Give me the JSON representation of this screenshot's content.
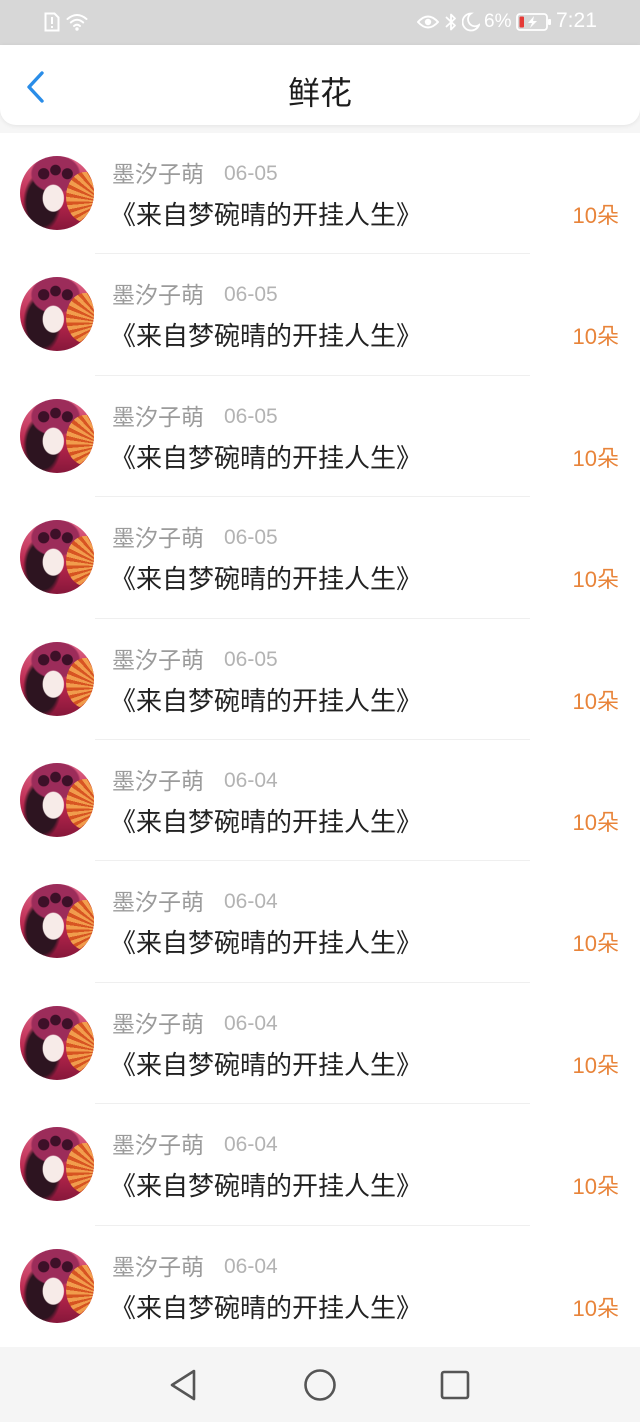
{
  "status_bar": {
    "left_icons": [
      "sim-alert-icon",
      "wifi-icon"
    ],
    "right_icons": [
      "eye-icon",
      "bluetooth-icon",
      "moon-icon",
      "battery-charging-icon"
    ],
    "battery_percent": "6%",
    "time": "7:21"
  },
  "header": {
    "back_icon": "chevron-left-icon",
    "title": "鲜花"
  },
  "flower_list": {
    "items": [
      {
        "name": "墨汐子萌",
        "date": "06-05",
        "title": "《来自梦碗晴的开挂人生》",
        "amount": "10朵"
      },
      {
        "name": "墨汐子萌",
        "date": "06-05",
        "title": "《来自梦碗晴的开挂人生》",
        "amount": "10朵"
      },
      {
        "name": "墨汐子萌",
        "date": "06-05",
        "title": "《来自梦碗晴的开挂人生》",
        "amount": "10朵"
      },
      {
        "name": "墨汐子萌",
        "date": "06-05",
        "title": "《来自梦碗晴的开挂人生》",
        "amount": "10朵"
      },
      {
        "name": "墨汐子萌",
        "date": "06-05",
        "title": "《来自梦碗晴的开挂人生》",
        "amount": "10朵"
      },
      {
        "name": "墨汐子萌",
        "date": "06-04",
        "title": "《来自梦碗晴的开挂人生》",
        "amount": "10朵"
      },
      {
        "name": "墨汐子萌",
        "date": "06-04",
        "title": "《来自梦碗晴的开挂人生》",
        "amount": "10朵"
      },
      {
        "name": "墨汐子萌",
        "date": "06-04",
        "title": "《来自梦碗晴的开挂人生》",
        "amount": "10朵"
      },
      {
        "name": "墨汐子萌",
        "date": "06-04",
        "title": "《来自梦碗晴的开挂人生》",
        "amount": "10朵"
      },
      {
        "name": "墨汐子萌",
        "date": "06-04",
        "title": "《来自梦碗晴的开挂人生》",
        "amount": "10朵"
      }
    ]
  },
  "nav_bar": {
    "icons": [
      "back-triangle-icon",
      "home-circle-icon",
      "recents-square-icon"
    ]
  },
  "colors": {
    "accent_blue": "#2a8de8",
    "amount_orange": "#e8843a",
    "status_bar_bg": "#d7d7d7",
    "battery_low_red": "#e53935",
    "title_text": "#222222",
    "secondary_text": "#9b9b9b"
  }
}
